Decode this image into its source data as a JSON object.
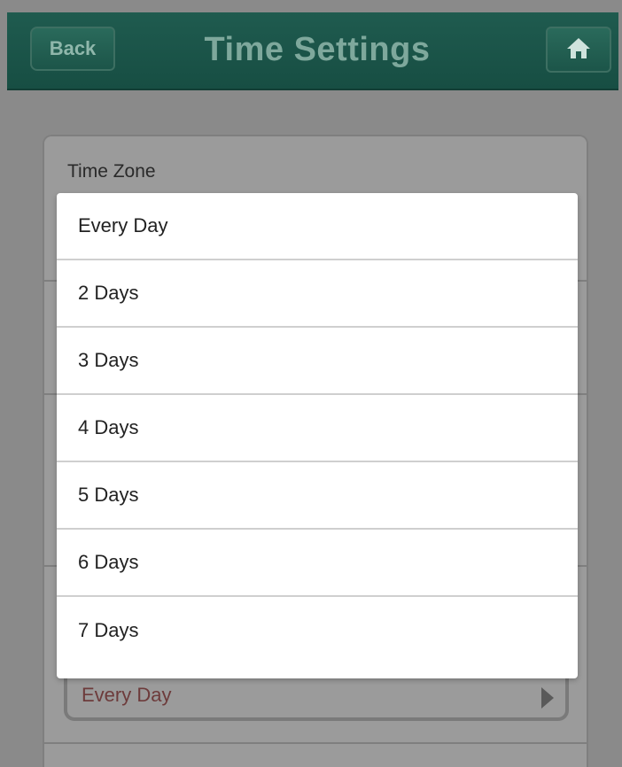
{
  "header": {
    "back_label": "Back",
    "title": "Time Settings",
    "home_icon": "home-icon"
  },
  "panel": {
    "time_zone_label": "Time Zone",
    "selected_value": "Every Day",
    "arrow_icon": "chevron-right-icon"
  },
  "dropdown": {
    "options": [
      "Every Day",
      "2 Days",
      "3 Days",
      "4 Days",
      "5 Days",
      "6 Days",
      "7 Days"
    ]
  },
  "colors": {
    "header_bg": "#1f5b4f",
    "header_text": "#7ea89c",
    "overlay_bg": "#8a8a8a",
    "selected_value_text": "#6d3b3b"
  }
}
